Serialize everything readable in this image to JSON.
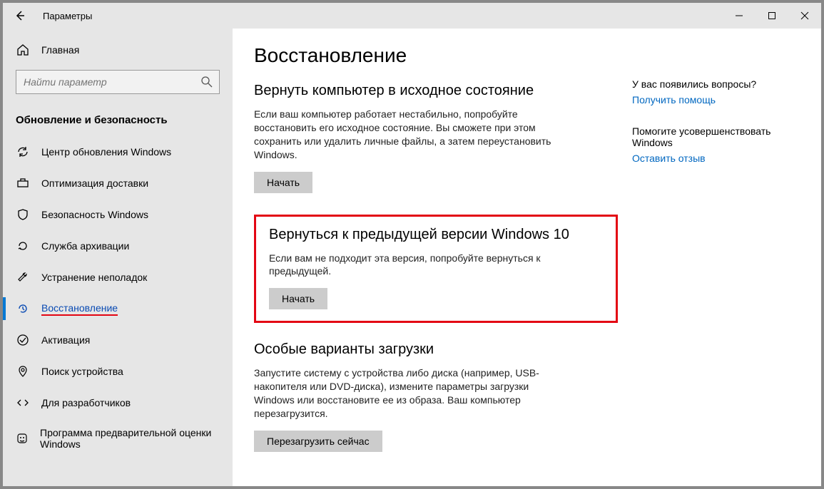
{
  "titlebar": {
    "title": "Параметры"
  },
  "sidebar": {
    "home_label": "Главная",
    "search_placeholder": "Найти параметр",
    "section_title": "Обновление и безопасность",
    "items": [
      {
        "label": "Центр обновления Windows"
      },
      {
        "label": "Оптимизация доставки"
      },
      {
        "label": "Безопасность Windows"
      },
      {
        "label": "Служба архивации"
      },
      {
        "label": "Устранение неполадок"
      },
      {
        "label": "Восстановление"
      },
      {
        "label": "Активация"
      },
      {
        "label": "Поиск устройства"
      },
      {
        "label": "Для разработчиков"
      },
      {
        "label": "Программа предварительной оценки Windows"
      }
    ]
  },
  "main": {
    "page_title": "Восстановление",
    "reset": {
      "heading": "Вернуть компьютер в исходное состояние",
      "text": "Если ваш компьютер работает нестабильно, попробуйте восстановить его исходное состояние. Вы сможете при этом сохранить или удалить личные файлы, а затем переустановить Windows.",
      "button": "Начать"
    },
    "goback": {
      "heading": "Вернуться к предыдущей версии Windows 10",
      "text": "Если вам не подходит эта версия, попробуйте вернуться к предыдущей.",
      "button": "Начать"
    },
    "advanced": {
      "heading": "Особые варианты загрузки",
      "text": "Запустите систему с устройства либо диска (например, USB-накопителя или DVD-диска), измените параметры загрузки Windows или восстановите ее из образа. Ваш компьютер перезагрузится.",
      "button": "Перезагрузить сейчас"
    }
  },
  "aside": {
    "q1": "У вас появились вопросы?",
    "link1": "Получить помощь",
    "q2": "Помогите усовершенствовать Windows",
    "link2": "Оставить отзыв"
  }
}
